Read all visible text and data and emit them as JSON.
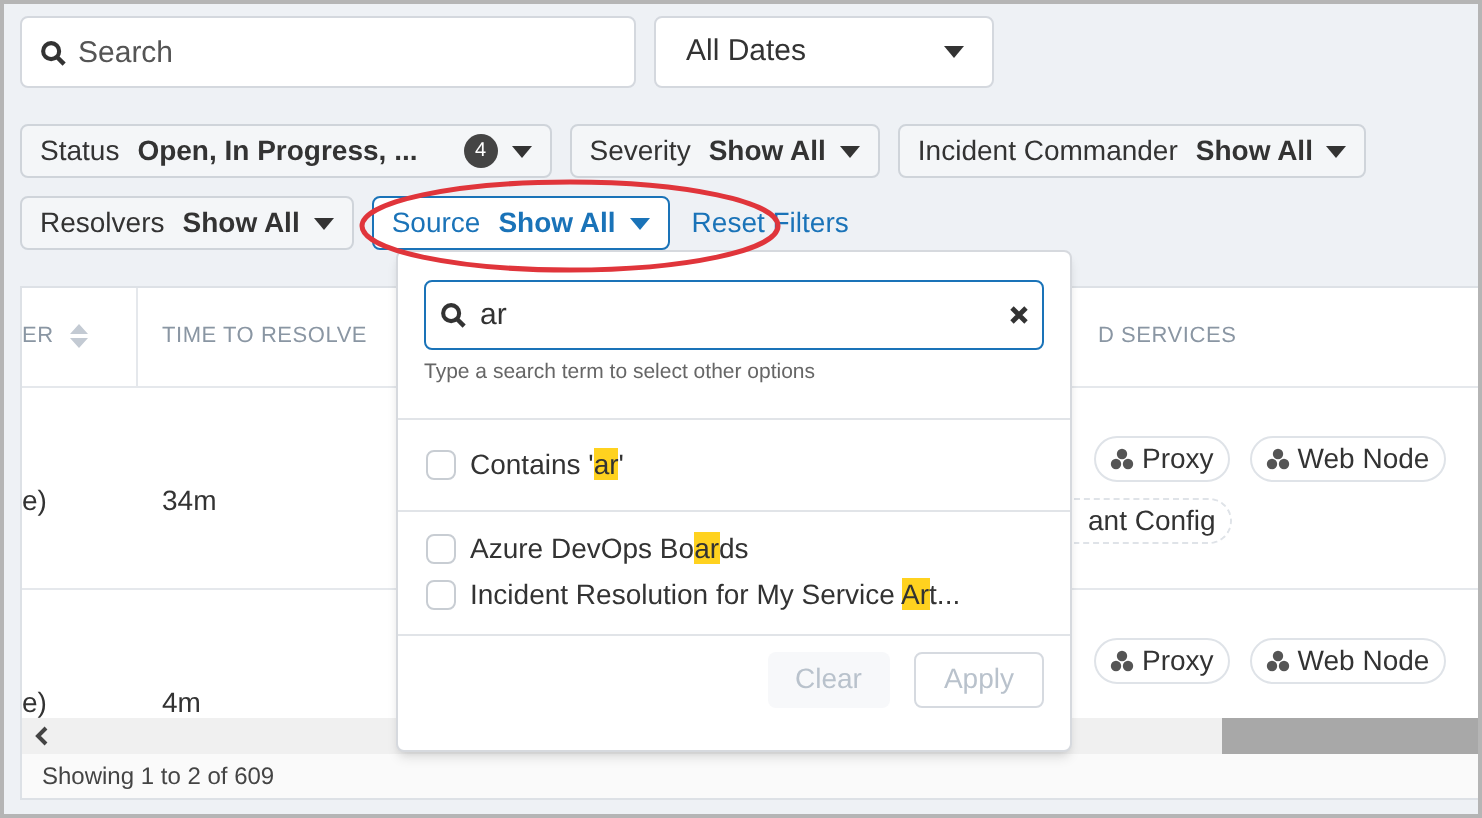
{
  "search": {
    "placeholder": "Search"
  },
  "date_filter": {
    "value": "All Dates"
  },
  "filters": [
    {
      "label": "Status",
      "value": "Open, In Progress, ...",
      "count": "4",
      "active": false
    },
    {
      "label": "Severity",
      "value": "Show All",
      "active": false
    },
    {
      "label": "Incident Commander",
      "value": "Show All",
      "active": false
    },
    {
      "label": "Resolvers",
      "value": "Show All",
      "active": false
    },
    {
      "label": "Source",
      "value": "Show All",
      "active": true
    }
  ],
  "reset_link": "Reset Filters",
  "table": {
    "columns": [
      "ER",
      "TIME TO RESOLVE",
      "D SERVICES"
    ],
    "rows": [
      {
        "column_1": "e)",
        "time_to_resolve": "34m",
        "services": [
          {
            "text": "Proxy",
            "kind": "service"
          },
          {
            "text": "Web Node",
            "kind": "service"
          },
          {
            "text": "ant Config",
            "kind": "dashed"
          }
        ]
      },
      {
        "column_1": "e)",
        "time_to_resolve": "4m",
        "services": [
          {
            "text": "Proxy",
            "kind": "service"
          },
          {
            "text": "Web Node",
            "kind": "service"
          }
        ]
      }
    ],
    "footer": "Showing 1 to 2 of 609"
  },
  "dropdown": {
    "search_value": "ar",
    "hint": "Type a search term to select other options",
    "options": [
      {
        "parts": [
          {
            "text": "Contains '"
          },
          {
            "text": "ar",
            "match": true
          },
          {
            "text": "'"
          }
        ],
        "checked": false,
        "kind": "contains"
      },
      {
        "parts": [
          {
            "text": "Azure DevOps Bo"
          },
          {
            "text": "ar",
            "match": true
          },
          {
            "text": "ds"
          }
        ],
        "checked": false,
        "kind": "option"
      },
      {
        "parts": [
          {
            "text": "Incident Resolution for My Service "
          },
          {
            "text": "Ar",
            "match": true
          },
          {
            "text": "t..."
          }
        ],
        "checked": false,
        "kind": "option"
      }
    ],
    "buttons": [
      {
        "label": "Clear",
        "disabled": true
      },
      {
        "label": "Apply",
        "disabled": true
      }
    ]
  }
}
